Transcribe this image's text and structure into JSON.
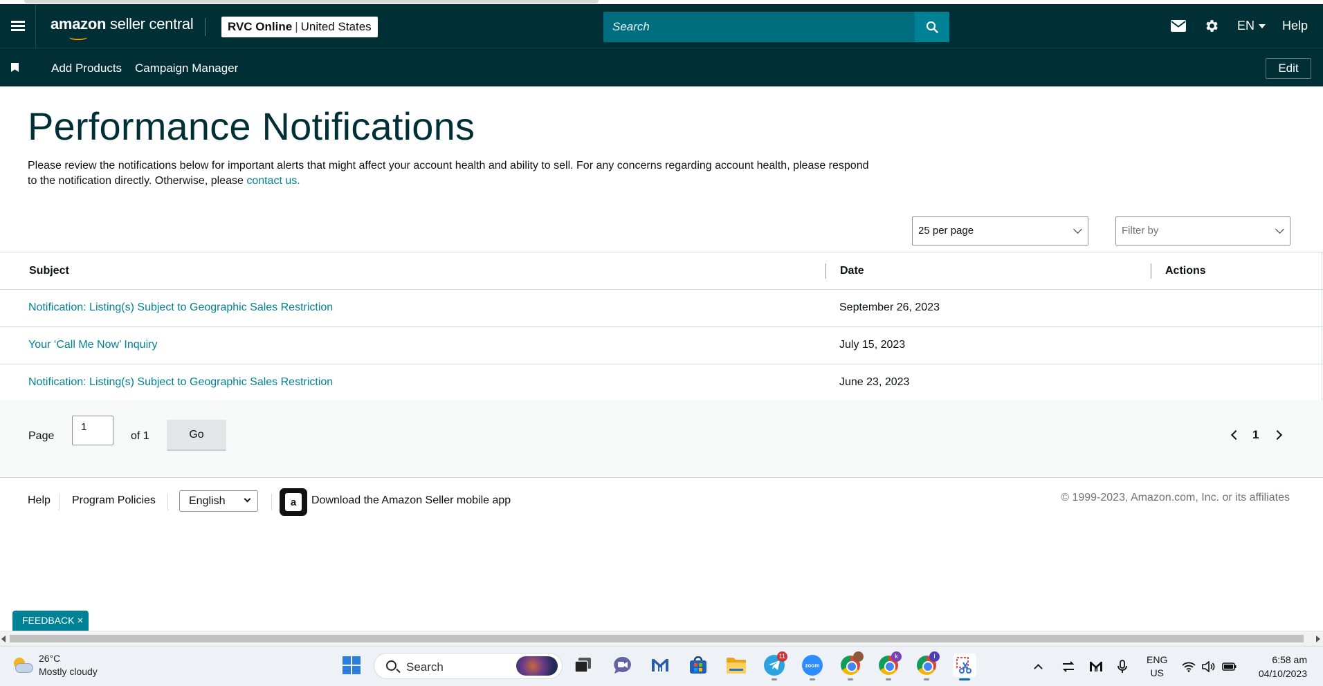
{
  "header": {
    "logo_brand": "amazon",
    "logo_rest": " seller central",
    "account_name": "RVC Online",
    "account_sep": "|",
    "account_region": "United States",
    "search_placeholder": "Search",
    "language": "EN",
    "help": "Help"
  },
  "subnav": {
    "links": [
      "Add Products",
      "Campaign Manager"
    ],
    "edit_label": "Edit"
  },
  "page": {
    "title": "Performance Notifications",
    "intro": "Please review the notifications below for important alerts that might affect your account health and ability to sell. For any concerns regarding account health, please respond to the notification directly. Otherwise, please",
    "contact_link": "contact us."
  },
  "controls": {
    "per_page": "25 per page",
    "filter_placeholder": "Filter by"
  },
  "table": {
    "headers": [
      "Subject",
      "Date",
      "Actions"
    ],
    "rows": [
      {
        "subject": "Notification: Listing(s) Subject to Geographic Sales Restriction",
        "date": "September 26, 2023"
      },
      {
        "subject": "Your ‘Call Me Now’ Inquiry",
        "date": "July 15, 2023"
      },
      {
        "subject": "Notification: Listing(s) Subject to Geographic Sales Restriction",
        "date": "June 23, 2023"
      }
    ]
  },
  "pager": {
    "page_label": "Page",
    "page_value": "1",
    "of_label": "of 1",
    "go_label": "Go",
    "current_page": "1"
  },
  "footer": {
    "help": "Help",
    "program_policies": "Program Policies",
    "language": "English",
    "download_app": "Download the Amazon Seller mobile app",
    "copyright": "© 1999-2023, Amazon.com, Inc. or its affiliates"
  },
  "feedback": {
    "label": "FEEDBACK",
    "close": "×"
  },
  "taskbar": {
    "weather_temp": "26°C",
    "weather_desc": "Mostly cloudy",
    "search_label": "Search",
    "telegram_badge": "11",
    "chrome_k_badge": "k",
    "chrome_i_badge": "I",
    "input_lang": "ENG",
    "input_region": "US",
    "time": "6:58 am",
    "date": "04/10/2023"
  },
  "colors": {
    "nav_bg": "#002f36",
    "search_bg": "#006e7f",
    "link": "#008296",
    "title": "#002f36"
  },
  "icons": [
    "hamburger-icon",
    "search-icon",
    "mail-icon",
    "gear-icon",
    "bookmark-icon",
    "chevron-down-icon",
    "chevron-left-icon",
    "chevron-right-icon",
    "amazon-app-icon",
    "close-icon"
  ]
}
